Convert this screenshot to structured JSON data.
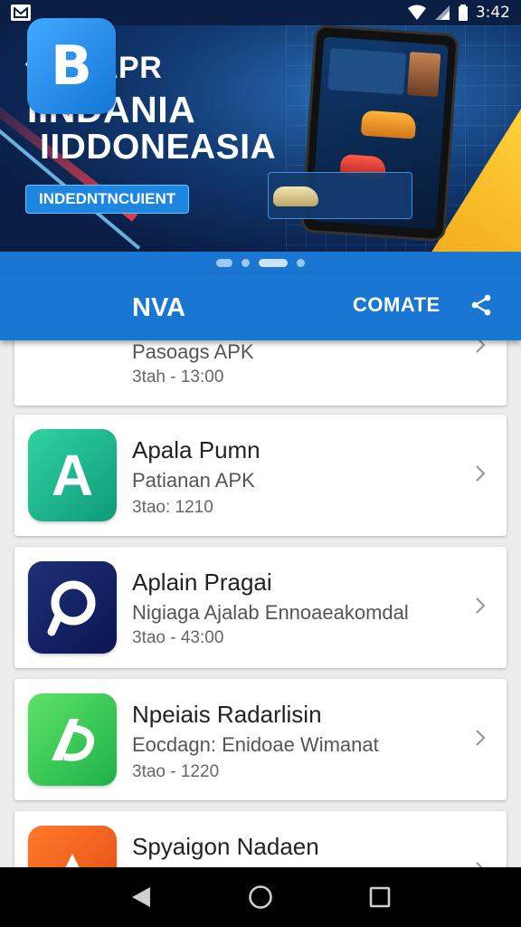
{
  "status_bar": {
    "time": "3:42",
    "icons": [
      "gmail-icon",
      "wifi-icon",
      "signal-icon",
      "battery-icon"
    ]
  },
  "banner": {
    "title": "APR",
    "headline_line1": "IINDANIA",
    "headline_line2": "IIDDONEASIA",
    "badge": "INDEDNTNCUIENT",
    "carousel": {
      "count": 4,
      "active_index": 2
    }
  },
  "header": {
    "logo_letter": "B",
    "title": "NVA",
    "action_label": "COMATE",
    "share_icon": "share-icon"
  },
  "apps": [
    {
      "name": "",
      "subtitle": "Pasoags APK",
      "meta": "3tah - 13:00",
      "icon_letter": "B",
      "color_from": "#43a9ff",
      "color_to": "#1376d6"
    },
    {
      "name": "Apala Pumn",
      "subtitle": "Patianan APK",
      "meta": "3tao: 1210",
      "icon_letter": "A",
      "color_from": "#2fd3a3",
      "color_to": "#0f9a78"
    },
    {
      "name": "Aplain Pragai",
      "subtitle": "Nigiaga Ajalab Ennoaeakomdal",
      "meta": "3tao - 43:00",
      "icon_letter": "P",
      "color_from": "#1f2f7a",
      "color_to": "#0b1650"
    },
    {
      "name": "Npeiais Radarlisin",
      "subtitle": "Eocdagn: Enidoae Wimanat",
      "meta": "3tao - 1220",
      "icon_letter": "P",
      "color_from": "#5de267",
      "color_to": "#1fb24a"
    },
    {
      "name": "Spyaigon Nadaen",
      "subtitle": "",
      "meta": "",
      "icon_letter": "",
      "color_from": "#ff7a2a",
      "color_to": "#e24a14"
    }
  ],
  "nav": {
    "back": "back-icon",
    "home": "home-icon",
    "recents": "recents-icon"
  }
}
